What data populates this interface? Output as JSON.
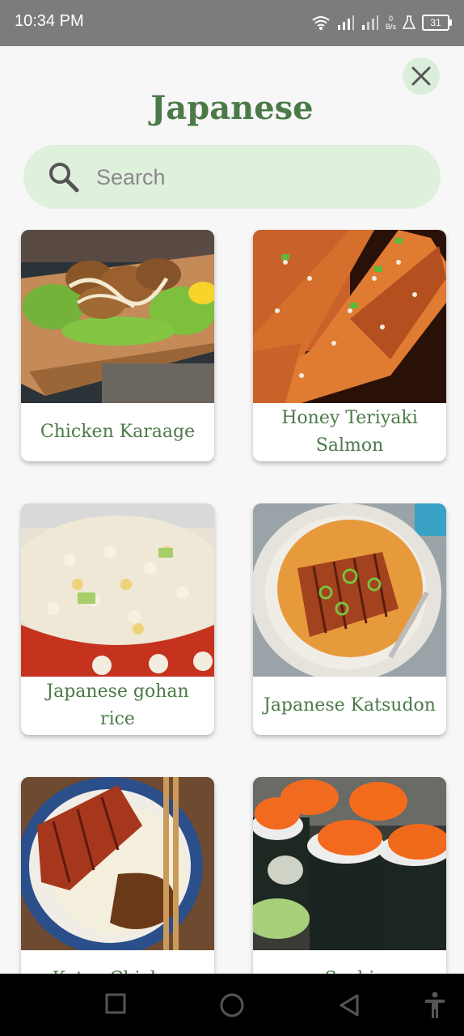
{
  "status_bar": {
    "time": "10:34 PM",
    "net_speed_value": "0",
    "net_speed_unit": "B/s",
    "battery": "31"
  },
  "header": {
    "title": "Japanese"
  },
  "search": {
    "placeholder": "Search"
  },
  "recipes": [
    {
      "name": "Chicken Karaage"
    },
    {
      "name": "Honey Teriyaki Salmon"
    },
    {
      "name": "Japanese gohan rice"
    },
    {
      "name": "Japanese Katsudon"
    },
    {
      "name": "Katsu Chicken"
    },
    {
      "name": "Sushi"
    }
  ],
  "colors": {
    "title_green": "#4b7a48",
    "search_bg": "#dff0dc",
    "close_bg": "#dbeedb",
    "status_bar": "#7c7c7c"
  },
  "icons": {
    "close": "close-icon",
    "search": "search-icon",
    "nav_recents": "square-icon",
    "nav_home": "circle-icon",
    "nav_back": "triangle-back-icon",
    "accessibility": "accessibility-icon"
  }
}
